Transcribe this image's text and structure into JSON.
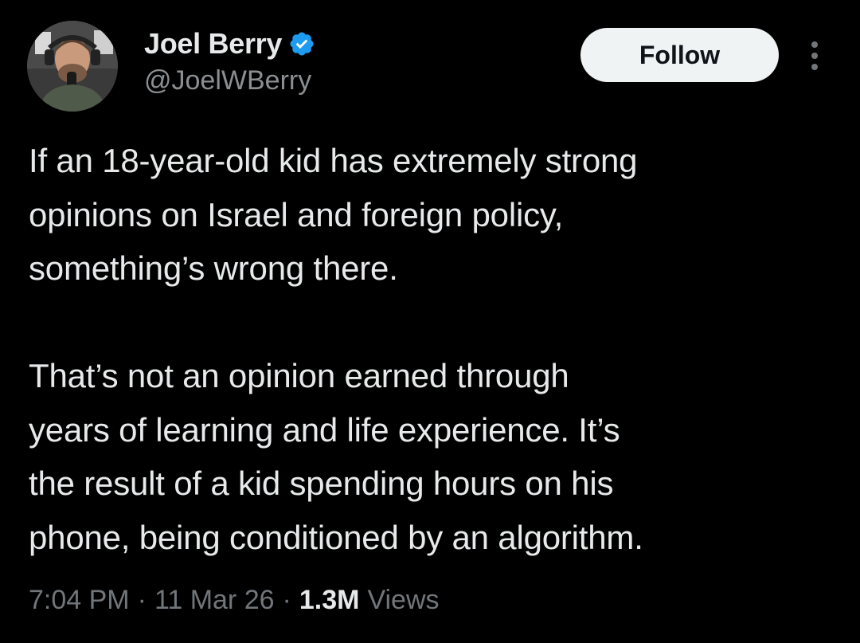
{
  "author": {
    "display_name": "Joel Berry",
    "handle": "@JoelWBerry",
    "verified": true,
    "avatar_icon": "profile-photo-avatar"
  },
  "actions": {
    "follow_label": "Follow",
    "more_icon": "vertical-ellipsis-icon"
  },
  "tweet": {
    "text": "If an 18-year-old kid has extremely strong\nopinions on Israel and foreign policy,\nsomething’s wrong there.\n\nThat’s not an opinion earned through\nyears of learning and life experience. It’s\nthe result of a kid spending hours on his\nphone, being conditioned by an algorithm."
  },
  "meta": {
    "time": "7:04 PM",
    "date": "11 Mar 26",
    "separator": "·",
    "views_count": "1.3M",
    "views_label": "Views"
  },
  "colors": {
    "background": "#000000",
    "text_primary": "#e7e9ea",
    "text_secondary": "#71767b",
    "verified_blue": "#1d9bf0",
    "follow_bg": "#eff3f4"
  }
}
